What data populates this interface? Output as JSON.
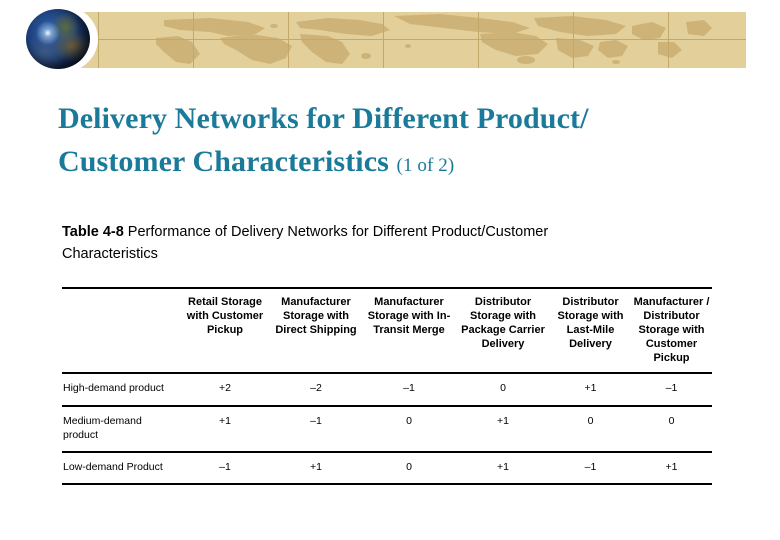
{
  "banner": {
    "background_color": "#e3cf9a",
    "gridline_color": "#c2a968",
    "landmass_color": "#cdb377",
    "globe_icon": "globe-icon"
  },
  "title": {
    "line1": "Delivery Networks for Different Product/",
    "line2": "Customer Characteristics",
    "suffix": "(1 of 2)",
    "color": "#1a7a99"
  },
  "caption": {
    "label": "Table 4-8",
    "text": " Performance of Delivery Networks for Different Product/Customer Characteristics"
  },
  "table": {
    "row_header_label": "",
    "columns": [
      "Retail Storage with Customer Pickup",
      "Manufacturer Storage with Direct Shipping",
      "Manufacturer Storage with In-Transit Merge",
      "Distributor Storage with Package Carrier Delivery",
      "Distributor Storage with Last-Mile Delivery",
      "Manufacturer / Distributor Storage with Customer Pickup"
    ],
    "rows": [
      {
        "label": "High-demand product",
        "values": [
          "+2",
          "–2",
          "–1",
          "0",
          "+1",
          "–1"
        ]
      },
      {
        "label": "Medium-demand product",
        "values": [
          "+1",
          "–1",
          "0",
          "+1",
          "0",
          "0"
        ]
      },
      {
        "label": "Low-demand Product",
        "values": [
          "–1",
          "+1",
          "0",
          "+1",
          "–1",
          "+1"
        ]
      }
    ]
  }
}
